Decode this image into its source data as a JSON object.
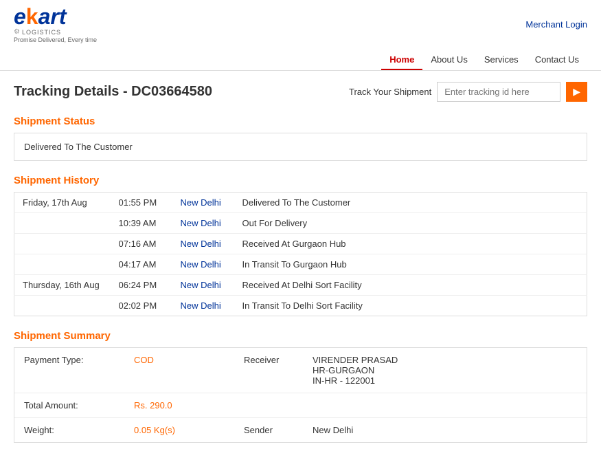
{
  "header": {
    "logo_main": "ekart",
    "logo_highlight": "k",
    "logo_sub": "LOGISTICS",
    "logo_tagline": "Promise Delivered, Every time",
    "merchant_login": "Merchant Login",
    "nav": [
      {
        "label": "Home",
        "active": true
      },
      {
        "label": "About Us",
        "active": false
      },
      {
        "label": "Services",
        "active": false
      },
      {
        "label": "Contact Us",
        "active": false
      }
    ]
  },
  "tracking": {
    "page_title": "Tracking Details - DC03664580",
    "track_label": "Track Your Shipment",
    "track_placeholder": "Enter tracking id here"
  },
  "shipment_status": {
    "section_title": "Shipment Status",
    "status_text": "Delivered To The Customer"
  },
  "shipment_history": {
    "section_title": "Shipment History",
    "rows": [
      {
        "date": "Friday, 17th Aug",
        "time": "01:55 PM",
        "location": "New Delhi",
        "status": "Delivered To The Customer"
      },
      {
        "date": "",
        "time": "10:39 AM",
        "location": "New Delhi",
        "status": "Out For Delivery"
      },
      {
        "date": "",
        "time": "07:16 AM",
        "location": "New Delhi",
        "status": "Received At Gurgaon Hub"
      },
      {
        "date": "",
        "time": "04:17 AM",
        "location": "New Delhi",
        "status": "In Transit To Gurgaon Hub"
      },
      {
        "date": "Thursday, 16th Aug",
        "time": "06:24 PM",
        "location": "New Delhi",
        "status": "Received At Delhi Sort Facility"
      },
      {
        "date": "",
        "time": "02:02 PM",
        "location": "New Delhi",
        "status": "In Transit To Delhi Sort Facility"
      }
    ]
  },
  "shipment_summary": {
    "section_title": "Shipment Summary",
    "rows": [
      {
        "label": "Payment Type:",
        "value": "COD",
        "right_label": "Receiver",
        "right_value": "VIRENDER PRASAD\nHR-GURGAON\nIN-HR - 122001"
      },
      {
        "label": "Total Amount:",
        "value": "Rs. 290.0",
        "right_label": "",
        "right_value": ""
      },
      {
        "label": "Weight:",
        "value": "0.05 Kg(s)",
        "right_label": "Sender",
        "right_value": "New Delhi"
      }
    ]
  }
}
